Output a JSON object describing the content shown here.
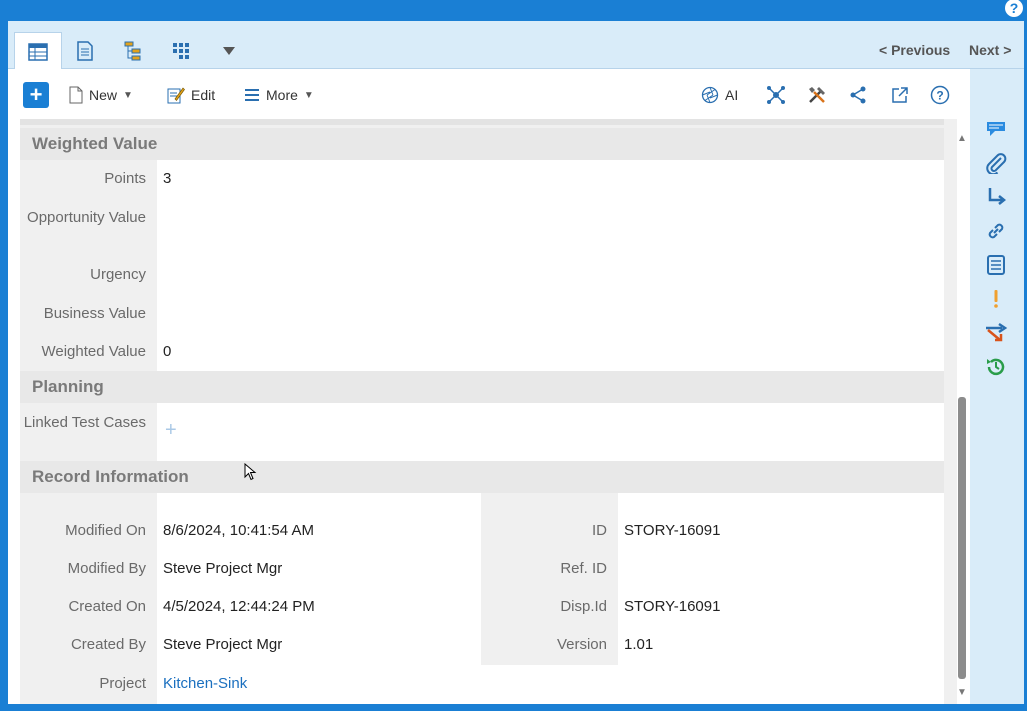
{
  "header": {
    "help_label": "?"
  },
  "tabs": {
    "items": [
      {
        "name": "grid-view-icon"
      },
      {
        "name": "document-view-icon"
      },
      {
        "name": "tree-view-icon"
      },
      {
        "name": "board-view-icon"
      },
      {
        "name": "more-views-icon"
      }
    ],
    "previous_label": "< Previous",
    "next_label": "Next >"
  },
  "toolbar": {
    "add_label": "+",
    "new_label": "New",
    "edit_label": "Edit",
    "more_label": "More",
    "ai_label": "AI"
  },
  "sections": {
    "weighted_value": {
      "title": "Weighted Value",
      "fields": [
        {
          "label": "Points",
          "value": "3"
        },
        {
          "label": "Opportunity Value",
          "value": ""
        },
        {
          "label": "Urgency",
          "value": ""
        },
        {
          "label": "Business Value",
          "value": ""
        },
        {
          "label": "Weighted Value",
          "value": "0"
        }
      ]
    },
    "planning": {
      "title": "Planning",
      "fields": [
        {
          "label": "Linked Test Cases",
          "value": "+"
        }
      ]
    },
    "record_information": {
      "title": "Record Information",
      "left_fields": [
        {
          "label": "Modified On",
          "value": "8/6/2024, 10:41:54 AM"
        },
        {
          "label": "Modified By",
          "value": "Steve Project Mgr"
        },
        {
          "label": "Created On",
          "value": "4/5/2024, 12:44:24 PM"
        },
        {
          "label": "Created By",
          "value": "Steve Project Mgr"
        },
        {
          "label": "Project",
          "value": "Kitchen-Sink"
        }
      ],
      "right_fields": [
        {
          "label": "ID",
          "value": "STORY-16091"
        },
        {
          "label": "Ref. ID",
          "value": ""
        },
        {
          "label": "Disp.Id",
          "value": "STORY-16091"
        },
        {
          "label": "Version",
          "value": "1.01"
        }
      ]
    }
  },
  "colors": {
    "brand_blue": "#1a7fd4",
    "link_blue": "#1a6fbf",
    "panel_light_blue": "#d9ecf9"
  }
}
